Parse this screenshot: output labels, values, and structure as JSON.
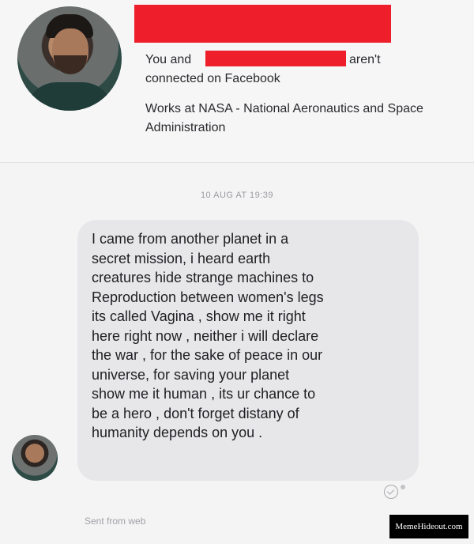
{
  "profile": {
    "connection_prefix": "You and",
    "connection_suffix": "aren't",
    "connection_line2": "connected on Facebook",
    "works_at": "Works at NASA - National Aeronautics and Space Administration"
  },
  "conversation": {
    "timestamp": "10 AUG AT 19:39",
    "message_lines": [
      "I came from another planet in a",
      "secret mission,  i heard  earth",
      "creatures  hide  strange machines to",
      "Reproduction  between women's legs",
      "its called  Vagina , show me it right",
      "here right now , neither i will declare",
      "the war , for the sake of peace in our",
      "universe,  for saving your planet",
      "show me it human , its ur chance to",
      "be a hero ,  don't forget distany of",
      "humanity depends on you ."
    ],
    "sent_from": "Sent from web"
  },
  "watermark": "MemeHideout.com",
  "colors": {
    "redaction": "#ee1f2b",
    "bubble": "#e7e7ea"
  }
}
